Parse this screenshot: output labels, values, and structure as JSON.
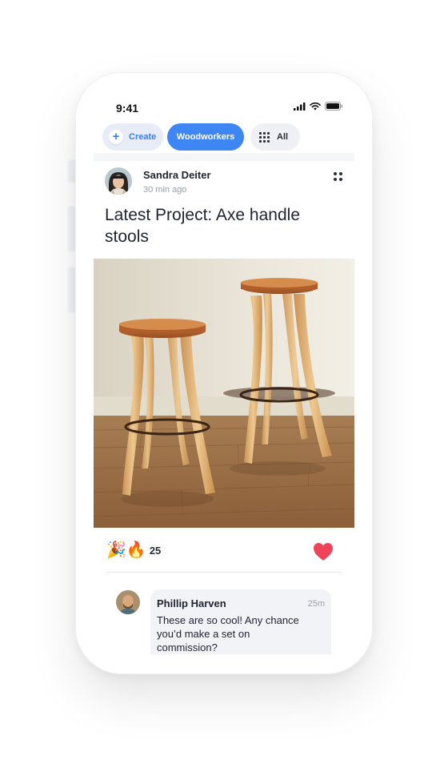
{
  "status_bar": {
    "time": "9:41",
    "icons": [
      "signal-icon",
      "wifi-icon",
      "battery-icon"
    ]
  },
  "filters": {
    "create_label": "Create",
    "woodworkers_label": "Woodworkers",
    "all_label": "All"
  },
  "post": {
    "author": "Sandra Deiter",
    "time_ago": "30 min ago",
    "title": "Latest Project:  Axe handle stools",
    "reactions": {
      "emojis": "🎉🔥",
      "count": "25"
    },
    "liked": true
  },
  "comment": {
    "author": "Phillip Harven",
    "time": "25m",
    "text": "These are so cool! Any chance you’d make a set on commission?"
  },
  "colors": {
    "accent": "#3f86f5",
    "heart": "#ef4458",
    "create_chip_bg": "#e7ecf7"
  }
}
